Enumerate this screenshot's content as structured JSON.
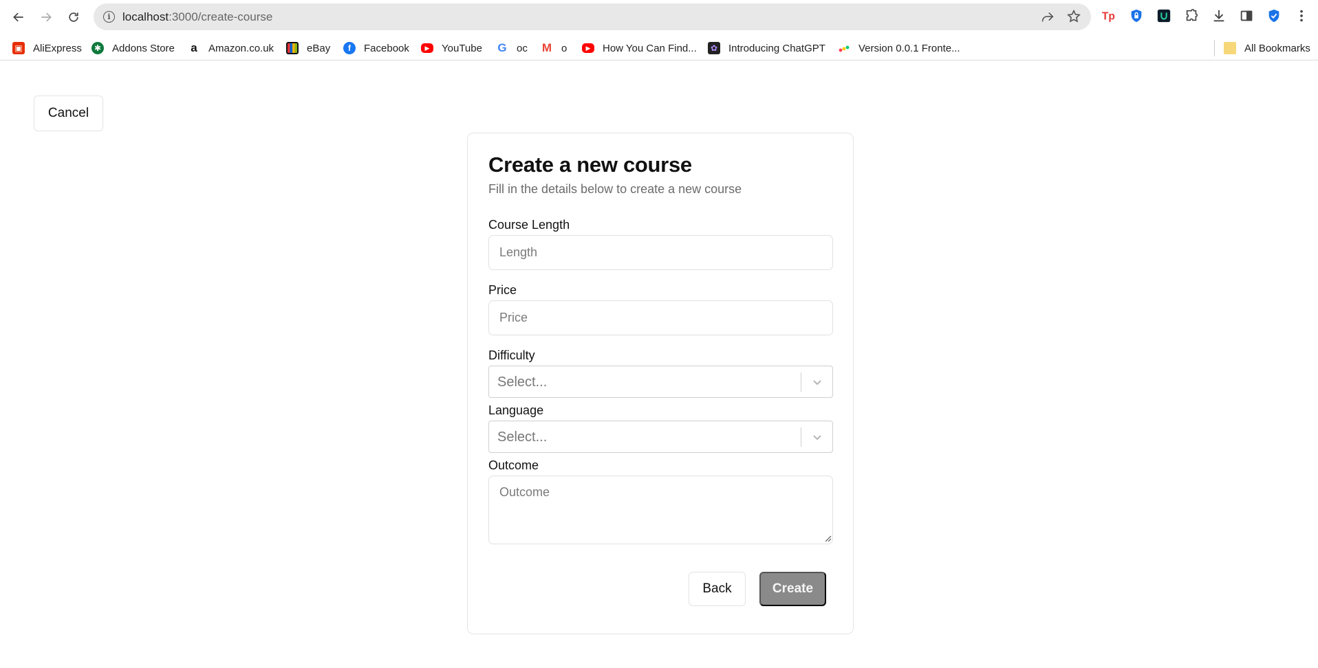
{
  "browser": {
    "url_host": "localhost",
    "url_path": ":3000/create-course"
  },
  "bookmarks": [
    {
      "label": "AliExpress",
      "icon": "aliexpress-icon",
      "color": "#e62e04"
    },
    {
      "label": "Addons Store",
      "icon": "addons-store-icon",
      "color": "#0f7a3c"
    },
    {
      "label": "Amazon.co.uk",
      "icon": "amazon-icon",
      "color": "#111111"
    },
    {
      "label": "eBay",
      "icon": "ebay-icon",
      "color": "#3665f3"
    },
    {
      "label": "Facebook",
      "icon": "facebook-icon",
      "color": "#1877f2"
    },
    {
      "label": "YouTube",
      "icon": "youtube-icon",
      "color": "#ff0000"
    },
    {
      "label": "oc",
      "icon": "google-icon",
      "color": "#4285f4"
    },
    {
      "label": "o",
      "icon": "gmail-icon",
      "color": "#ea4335"
    },
    {
      "label": "How You Can Find...",
      "icon": "youtube-icon",
      "color": "#ff0000"
    },
    {
      "label": "Introducing ChatGPT",
      "icon": "chatgpt-icon",
      "color": "#222222"
    },
    {
      "label": "Version 0.0.1 Fronte...",
      "icon": "monday-icon",
      "color": "#ff3d57"
    }
  ],
  "all_bookmarks_label": "All Bookmarks",
  "page": {
    "cancel_label": "Cancel",
    "title": "Create a new course",
    "subtitle": "Fill in the details below to create a new course",
    "course_length": {
      "label": "Course Length",
      "placeholder": "Length",
      "value": ""
    },
    "price": {
      "label": "Price",
      "placeholder": "Price",
      "value": ""
    },
    "difficulty": {
      "label": "Difficulty",
      "placeholder": "Select..."
    },
    "language": {
      "label": "Language",
      "placeholder": "Select..."
    },
    "outcome": {
      "label": "Outcome",
      "placeholder": "Outcome",
      "value": ""
    },
    "back_label": "Back",
    "create_label": "Create"
  },
  "colors": {
    "create_button": "#8a8a8a",
    "card_border": "#e5e5e5"
  }
}
